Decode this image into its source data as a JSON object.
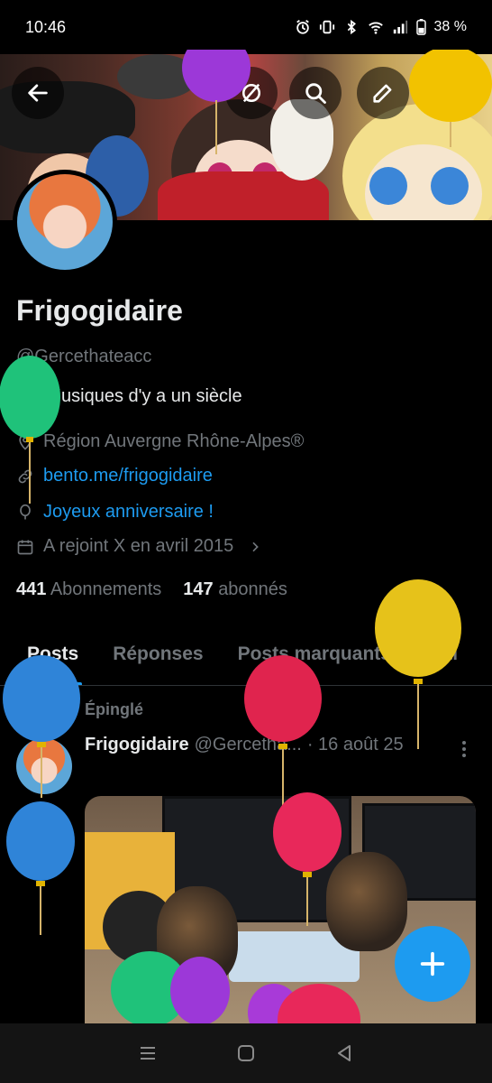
{
  "status_bar": {
    "time": "10:46",
    "battery": "38 %",
    "icons": [
      "alarm-icon",
      "vibrate-icon",
      "bluetooth-icon",
      "wifi-icon",
      "signal-icon",
      "battery-icon"
    ]
  },
  "top_actions": [
    "back-arrow-icon",
    "grok-icon",
    "search-icon",
    "edit-icon",
    "more-vertical-icon"
  ],
  "profile": {
    "name": "Frigogidaire",
    "handle": "@Gercethateacc",
    "bio": "20. Musiques d'y a un siècle",
    "location": "Région Auvergne Rhône-Alpes®",
    "website": "bento.me/frigogidaire",
    "birthday": "Joyeux anniversaire !",
    "joined": "A rejoint X en avril 2015",
    "following_count": "441",
    "following_label": "Abonnements",
    "followers_count": "147",
    "followers_label": "abonnés"
  },
  "tabs": [
    {
      "label": "Posts",
      "active": true
    },
    {
      "label": "Réponses",
      "active": false
    },
    {
      "label": "Posts marquants",
      "active": false
    },
    {
      "label": "Arti",
      "active": false
    }
  ],
  "pinned_post": {
    "pinned_label": "Épinglé",
    "author_name": "Frigogidaire",
    "author_handle": "@Gercetha...",
    "date": "· 16 août 25"
  },
  "colors": {
    "accent": "#1d9bf0",
    "background": "#000000",
    "text_primary": "#e7e9ea",
    "text_secondary": "#71767b"
  }
}
